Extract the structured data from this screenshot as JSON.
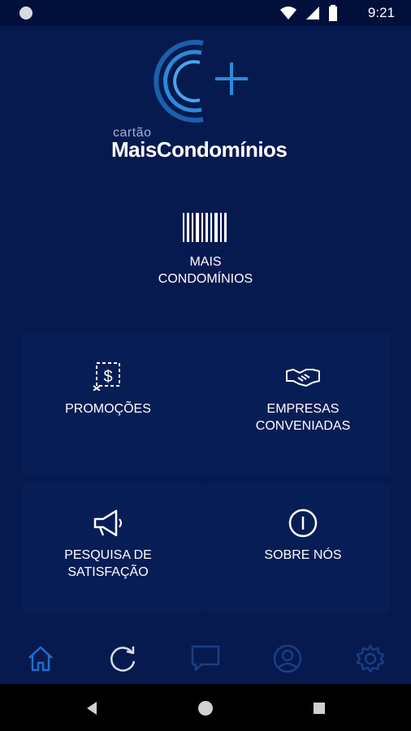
{
  "status_bar": {
    "time": "9:21"
  },
  "logo": {
    "small_text": "cartão",
    "brand_text": "MaisCondomínios"
  },
  "tiles": [
    {
      "line1": "MAIS",
      "line2": "CONDOMÍNIOS",
      "icon": "barcode-icon"
    },
    {
      "line1": "PROMOÇÕES",
      "line2": "",
      "icon": "coupon-dollar-icon"
    },
    {
      "line1": "EMPRESAS",
      "line2": "CONVENIADAS",
      "icon": "handshake-icon"
    },
    {
      "line1": "PESQUISA DE",
      "line2": "SATISFAÇÃO",
      "icon": "megaphone-icon"
    },
    {
      "line1": "SOBRE NÓS",
      "line2": "",
      "icon": "info-icon"
    }
  ],
  "bottom_nav": {
    "items": [
      "home-icon",
      "refresh-icon",
      "chat-icon",
      "profile-icon",
      "settings-icon"
    ],
    "active_color": "#1e6fd0",
    "inactive_color": "#1a3e83"
  },
  "colors": {
    "background": "#061a4f",
    "status_bar": "#01103a",
    "accent": "#1e6fd0"
  }
}
